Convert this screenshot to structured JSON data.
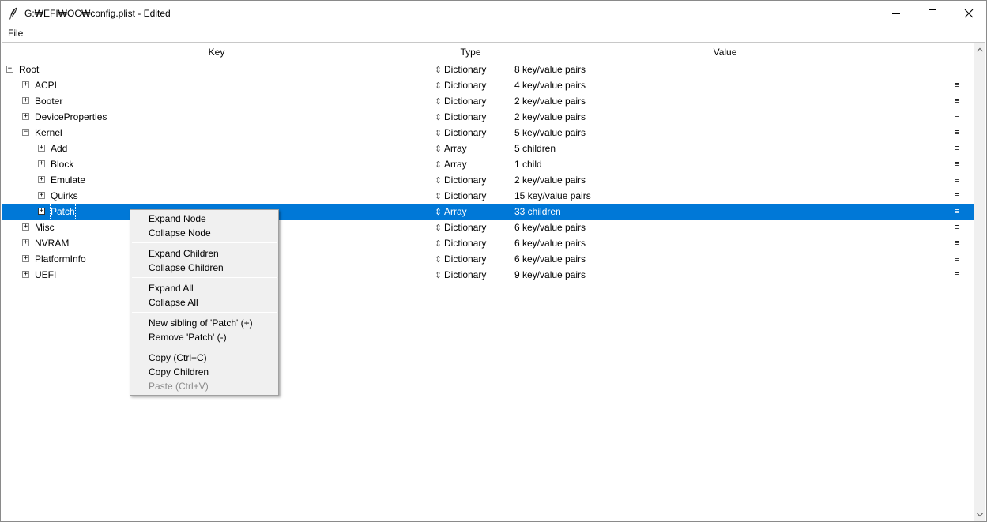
{
  "window": {
    "title": "G:₩EFI₩OC₩config.plist - Edited",
    "app_icon": "feather-pen-icon"
  },
  "menubar": {
    "file": "File"
  },
  "columns": {
    "key": "Key",
    "type": "Type",
    "value": "Value"
  },
  "rows": [
    {
      "key": "Root",
      "type": "Dictionary",
      "value": "8 key/value pairs",
      "toggle": "⊟"
    },
    {
      "key": "ACPI",
      "type": "Dictionary",
      "value": "4 key/value pairs",
      "toggle": "⊞"
    },
    {
      "key": "Booter",
      "type": "Dictionary",
      "value": "2 key/value pairs",
      "toggle": "⊞"
    },
    {
      "key": "DeviceProperties",
      "type": "Dictionary",
      "value": "2 key/value pairs",
      "toggle": "⊞"
    },
    {
      "key": "Kernel",
      "type": "Dictionary",
      "value": "5 key/value pairs",
      "toggle": "⊟"
    },
    {
      "key": "Add",
      "type": "Array",
      "value": "5 children",
      "toggle": "⊞"
    },
    {
      "key": "Block",
      "type": "Array",
      "value": "1 child",
      "toggle": "⊞"
    },
    {
      "key": "Emulate",
      "type": "Dictionary",
      "value": "2 key/value pairs",
      "toggle": "⊞"
    },
    {
      "key": "Quirks",
      "type": "Dictionary",
      "value": "15 key/value pairs",
      "toggle": "⊞"
    },
    {
      "key": "Patch",
      "type": "Array",
      "value": "33 children",
      "toggle": "⊞"
    },
    {
      "key": "Misc",
      "type": "Dictionary",
      "value": "6 key/value pairs",
      "toggle": "⊞"
    },
    {
      "key": "NVRAM",
      "type": "Dictionary",
      "value": "6 key/value pairs",
      "toggle": "⊞"
    },
    {
      "key": "PlatformInfo",
      "type": "Dictionary",
      "value": "6 key/value pairs",
      "toggle": "⊞"
    },
    {
      "key": "UEFI",
      "type": "Dictionary",
      "value": "9 key/value pairs",
      "toggle": "⊞"
    }
  ],
  "type_arrow": "⇕",
  "row_menu_glyph": "≡",
  "selection_color": "#0078d7",
  "context_menu": {
    "expand_node": "Expand Node",
    "collapse_node": "Collapse Node",
    "expand_children": "Expand Children",
    "collapse_children": "Collapse Children",
    "expand_all": "Expand All",
    "collapse_all": "Collapse All",
    "new_sibling": "New sibling of 'Patch' (+)",
    "remove": "Remove 'Patch' (-)",
    "copy": "Copy (Ctrl+C)",
    "copy_children": "Copy Children",
    "paste": "Paste (Ctrl+V)"
  }
}
